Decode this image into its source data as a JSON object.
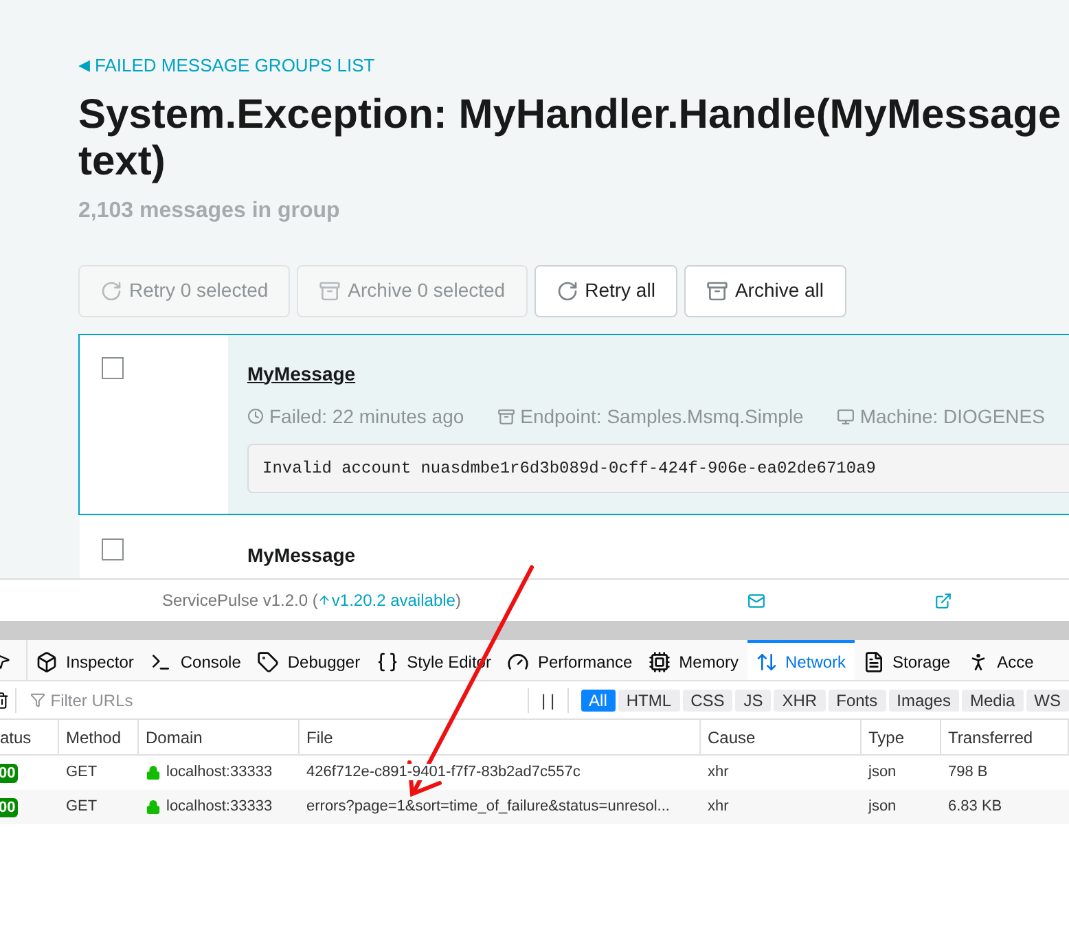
{
  "back_arrow": "◀",
  "back_link": "FAILED MESSAGE GROUPS LIST",
  "title": "System.Exception: MyHandler.Handle(MyMessage text)",
  "subtitle": "2,103 messages in group",
  "actions": [
    {
      "label": "Retry 0 selected",
      "kind": "retry",
      "disabled": true
    },
    {
      "label": "Archive 0 selected",
      "kind": "archive",
      "disabled": true
    },
    {
      "label": "Retry all",
      "kind": "retry",
      "disabled": false
    },
    {
      "label": "Archive all",
      "kind": "archive",
      "disabled": false
    }
  ],
  "messages": [
    {
      "name": "MyMessage",
      "selected": true,
      "checked": false,
      "failed": "Failed: 22 minutes ago",
      "endpoint": "Endpoint: Samples.Msmq.Simple",
      "machine": "Machine: DIOGENES",
      "exception": "Invalid account nuasdmbe1r6d3b089d-0cff-424f-906e-ea02de6710a9"
    },
    {
      "name": "MyMessage",
      "selected": false,
      "checked": false
    }
  ],
  "footer": {
    "version": "ServicePulse v1.2.0 (",
    "update": "v1.20.2 available",
    "close": ")"
  },
  "devtools": {
    "tabs": [
      {
        "label": "Inspector",
        "kind": "inspector",
        "selected": false
      },
      {
        "label": "Console",
        "kind": "console",
        "selected": false
      },
      {
        "label": "Debugger",
        "kind": "debugger",
        "selected": false
      },
      {
        "label": "Style Editor",
        "kind": "style",
        "selected": false
      },
      {
        "label": "Performance",
        "kind": "performance",
        "selected": false
      },
      {
        "label": "Memory",
        "kind": "memory",
        "selected": false
      },
      {
        "label": "Network",
        "kind": "network",
        "selected": true
      },
      {
        "label": "Storage",
        "kind": "storage",
        "selected": false
      },
      {
        "label": "Acce",
        "kind": "accessibility",
        "selected": false
      }
    ],
    "filter_placeholder": "Filter URLs",
    "pause": "| |",
    "filters": [
      {
        "label": "All",
        "selected": true
      },
      {
        "label": "HTML",
        "selected": false
      },
      {
        "label": "CSS",
        "selected": false
      },
      {
        "label": "JS",
        "selected": false
      },
      {
        "label": "XHR",
        "selected": false
      },
      {
        "label": "Fonts",
        "selected": false
      },
      {
        "label": "Images",
        "selected": false
      },
      {
        "label": "Media",
        "selected": false
      },
      {
        "label": "WS",
        "selected": false
      }
    ],
    "columns": [
      "atus",
      "Method",
      "Domain",
      "File",
      "Cause",
      "Type",
      "Transferred"
    ],
    "rows": [
      {
        "status": "00",
        "method": "GET",
        "domain": "localhost:33333",
        "file": "426f712e-c891-9401-f7f7-83b2ad7c557c",
        "cause": "xhr",
        "type": "json",
        "transferred": "798 B"
      },
      {
        "status": "00",
        "method": "GET",
        "domain": "localhost:33333",
        "file": "errors?page=1&sort=time_of_failure&status=unresol...",
        "cause": "xhr",
        "type": "json",
        "transferred": "6.83 KB"
      }
    ]
  }
}
